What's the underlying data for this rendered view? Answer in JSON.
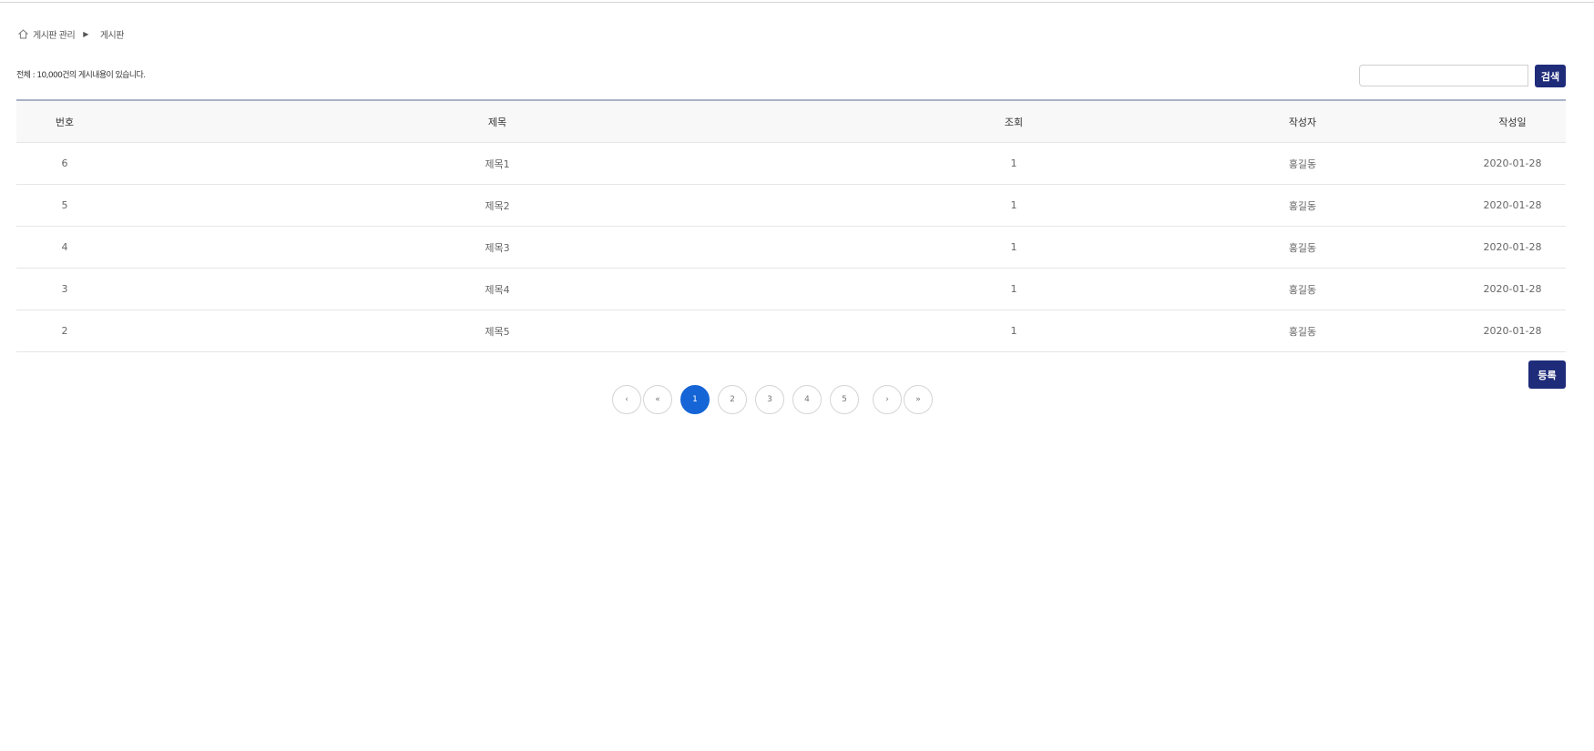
{
  "breadcrumb": {
    "items": [
      "게시판 관리",
      "게시판"
    ],
    "separator": "▶"
  },
  "total_text": "전체 : 10,000건의 게시내용이 있습니다.",
  "search": {
    "placeholder": "",
    "value": "",
    "button_label": "검색"
  },
  "table": {
    "headers": [
      "번호",
      "제목",
      "조회",
      "작성자",
      "작성일"
    ],
    "rows": [
      [
        "6",
        "제목1",
        "1",
        "홍길동",
        "2020-01-28"
      ],
      [
        "5",
        "제목2",
        "1",
        "홍길동",
        "2020-01-28"
      ],
      [
        "4",
        "제목3",
        "1",
        "홍길동",
        "2020-01-28"
      ],
      [
        "3",
        "제목4",
        "1",
        "홍길동",
        "2020-01-28"
      ],
      [
        "2",
        "제목5",
        "1",
        "홍길동",
        "2020-01-28"
      ]
    ]
  },
  "register_label": "등록",
  "pagination": {
    "prev": "‹",
    "first": "«",
    "pages": [
      "1",
      "2",
      "3",
      "4",
      "5"
    ],
    "current": "1",
    "next": "›",
    "last": "»"
  },
  "colors": {
    "primary_button": "#1f2c7a",
    "active_page": "#1565d6",
    "header_bg": "#f8f8f8"
  }
}
